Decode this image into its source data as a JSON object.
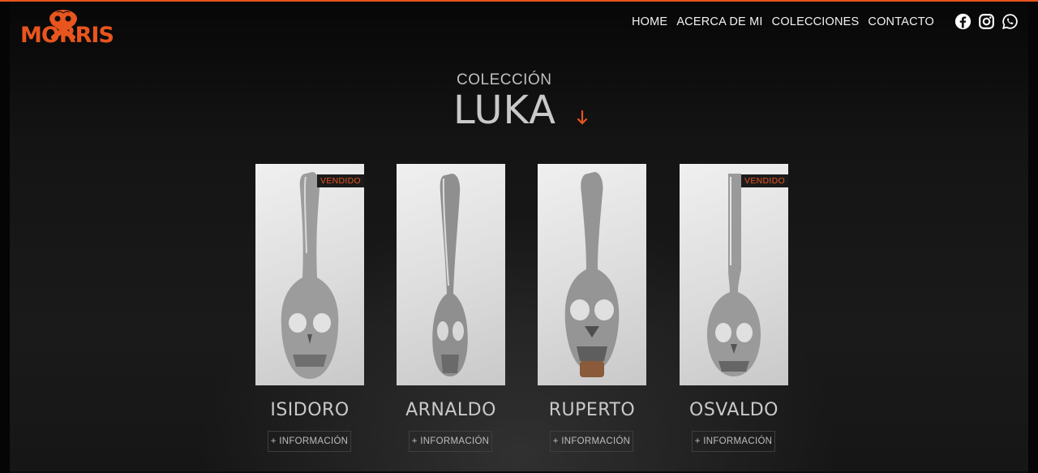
{
  "brand": {
    "logo_text": "MORRIS",
    "accent": "#e8551e"
  },
  "nav": {
    "items": [
      {
        "label": "HOME"
      },
      {
        "label": "ACERCA DE MI"
      },
      {
        "label": "COLECCIONES"
      },
      {
        "label": "CONTACTO"
      }
    ]
  },
  "socials": [
    {
      "icon": "facebook-icon"
    },
    {
      "icon": "instagram-icon"
    },
    {
      "icon": "whatsapp-icon"
    }
  ],
  "collection": {
    "label": "COLECCIÓN",
    "name": "LUKA",
    "arrow_icon": "arrow-down-icon"
  },
  "products": [
    {
      "name": "ISIDORO",
      "badge": "VENDIDO",
      "button": "+ INFORMACIÓN"
    },
    {
      "name": "ARNALDO",
      "badge": "",
      "button": "+ INFORMACIÓN"
    },
    {
      "name": "RUPERTO",
      "badge": "",
      "button": "+ INFORMACIÓN"
    },
    {
      "name": "OSVALDO",
      "badge": "VENDIDO",
      "button": "+ INFORMACIÓN"
    }
  ]
}
